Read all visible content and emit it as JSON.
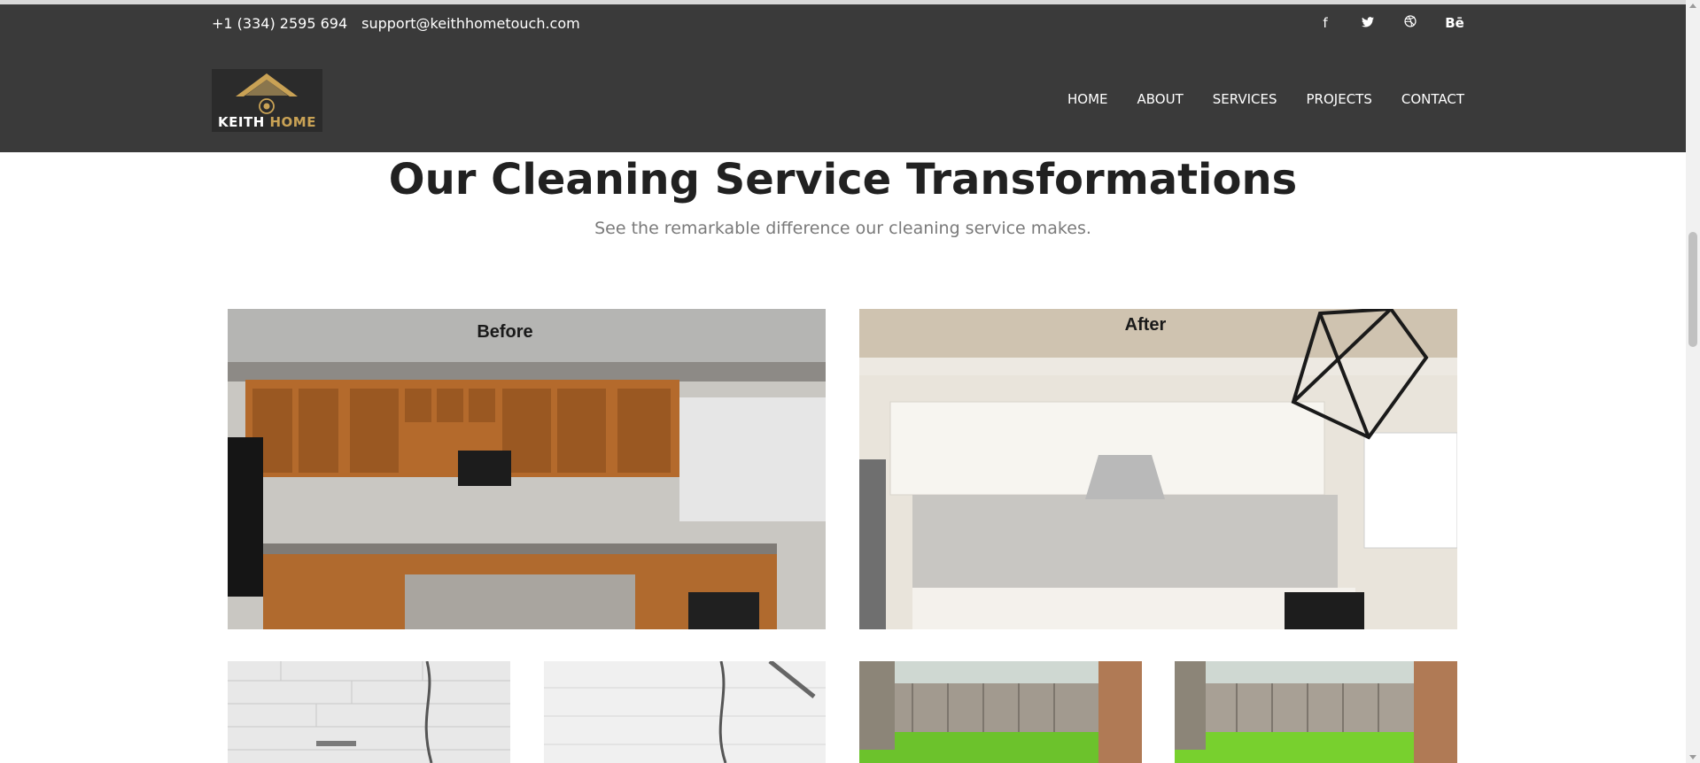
{
  "contact": {
    "phone": "+1 (334) 2595 694",
    "email": "support@keithhometouch.com"
  },
  "social": [
    {
      "icon": "facebook-icon",
      "glyph": "f"
    },
    {
      "icon": "twitter-icon",
      "glyph": "🐦"
    },
    {
      "icon": "dribbble-icon",
      "glyph": "⊛"
    },
    {
      "icon": "behance-icon",
      "glyph": "Bē"
    }
  ],
  "logo": {
    "word1": "KEITH",
    "word2": "HOME"
  },
  "nav": {
    "home": "HOME",
    "about": "ABOUT",
    "services": "SERVICES",
    "projects": "PROJECTS",
    "contact": "CONTACT"
  },
  "section": {
    "title": "Our Cleaning Service Transformations",
    "subtitle": "See the remarkable difference our cleaning service makes."
  },
  "gallery": {
    "before_label": "Before",
    "after_label": "After"
  },
  "colors": {
    "header_bg": "#3a3a3a",
    "accent_gold": "#c9a255",
    "title": "#212121",
    "subtitle": "#7a7a7a"
  }
}
